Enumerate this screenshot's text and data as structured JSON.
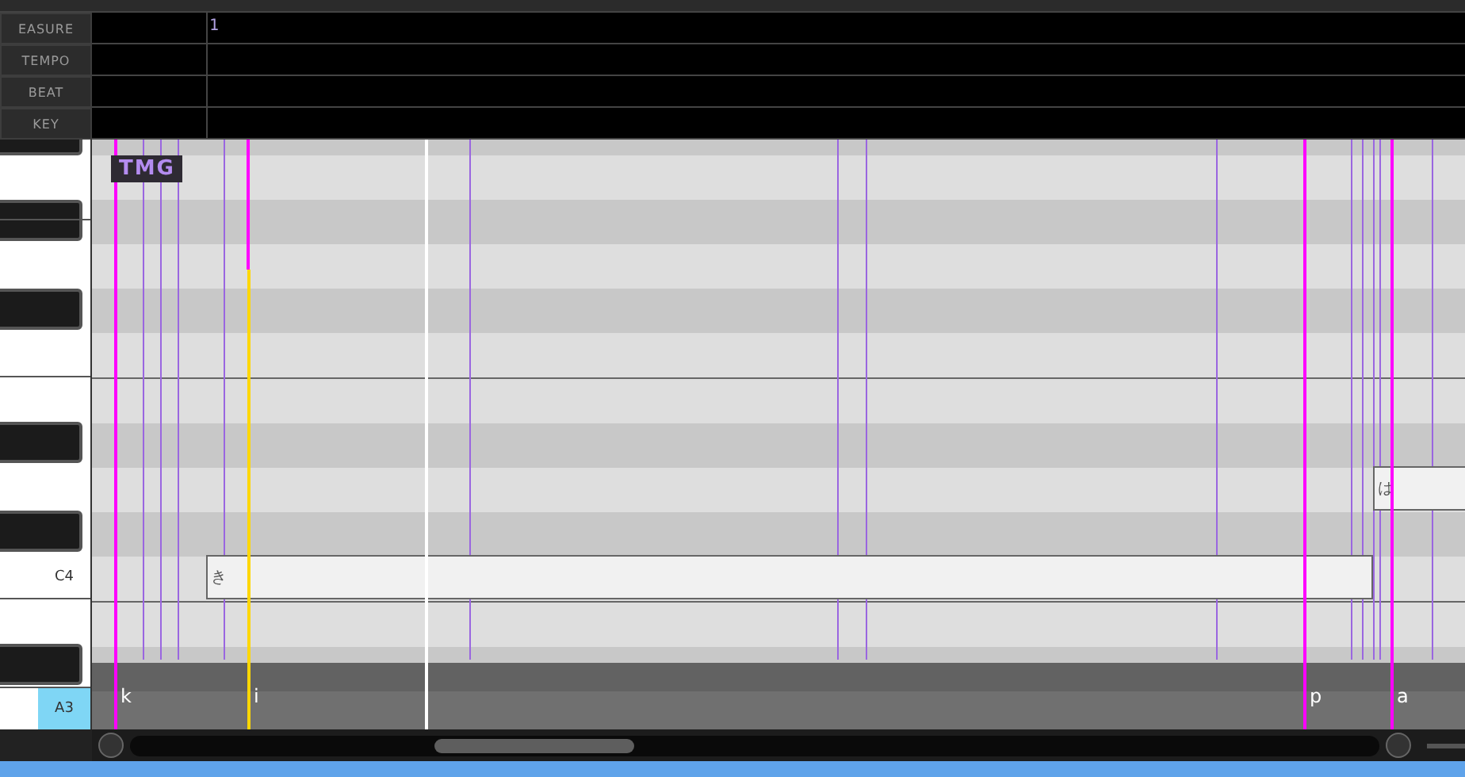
{
  "header_rows": [
    {
      "label": "EASURE"
    },
    {
      "label": "TEMPO"
    },
    {
      "label": "BEAT"
    },
    {
      "label": "KEY"
    }
  ],
  "measure_numbers": [
    "1"
  ],
  "keys": [
    {
      "label": "C4",
      "selected": false
    },
    {
      "label": "A3",
      "selected": true
    }
  ],
  "badge": "TMG",
  "notes": [
    {
      "lyric": "き"
    },
    {
      "lyric": "は"
    }
  ],
  "phonemes": [
    {
      "text": "k",
      "color": "#ff00ff"
    },
    {
      "text": "i",
      "color": "#ffd700"
    },
    {
      "text": "p",
      "color": "#ff00ff"
    },
    {
      "text": "a",
      "color": "#ff00ff"
    }
  ]
}
